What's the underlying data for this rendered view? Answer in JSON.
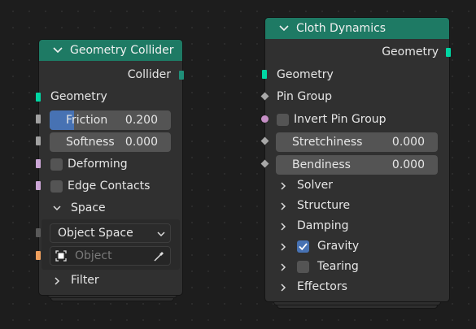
{
  "geometry_collider": {
    "title": "Geometry Collider",
    "output": "Collider",
    "input_geometry": "Geometry",
    "friction": {
      "label": "Friction",
      "value": "0.200",
      "fill": 0.2
    },
    "softness": {
      "label": "Softness",
      "value": "0.000"
    },
    "deforming": "Deforming",
    "edge_contacts": "Edge Contacts",
    "space_panel": "Space",
    "space_select": "Object Space",
    "object_placeholder": "Object",
    "filter_panel": "Filter"
  },
  "cloth_dynamics": {
    "title": "Cloth Dynamics",
    "output": "Geometry",
    "input_geometry": "Geometry",
    "pin_group": "Pin Group",
    "invert_pin_group": "Invert Pin Group",
    "stretchiness": {
      "label": "Stretchiness",
      "value": "0.000"
    },
    "bendiness": {
      "label": "Bendiness",
      "value": "0.000"
    },
    "panels": {
      "solver": "Solver",
      "structure": "Structure",
      "damping": "Damping",
      "gravity": "Gravity",
      "tearing": "Tearing",
      "effectors": "Effectors"
    },
    "gravity_checked": true,
    "tearing_checked": false
  },
  "colors": {
    "header": "#1e7a64",
    "geometry_socket": "#00d6a3",
    "float_socket": "#a1a1a1",
    "bool_socket": "#cca6d6",
    "object_socket": "#ed9e5c",
    "accent": "#4772b3"
  }
}
